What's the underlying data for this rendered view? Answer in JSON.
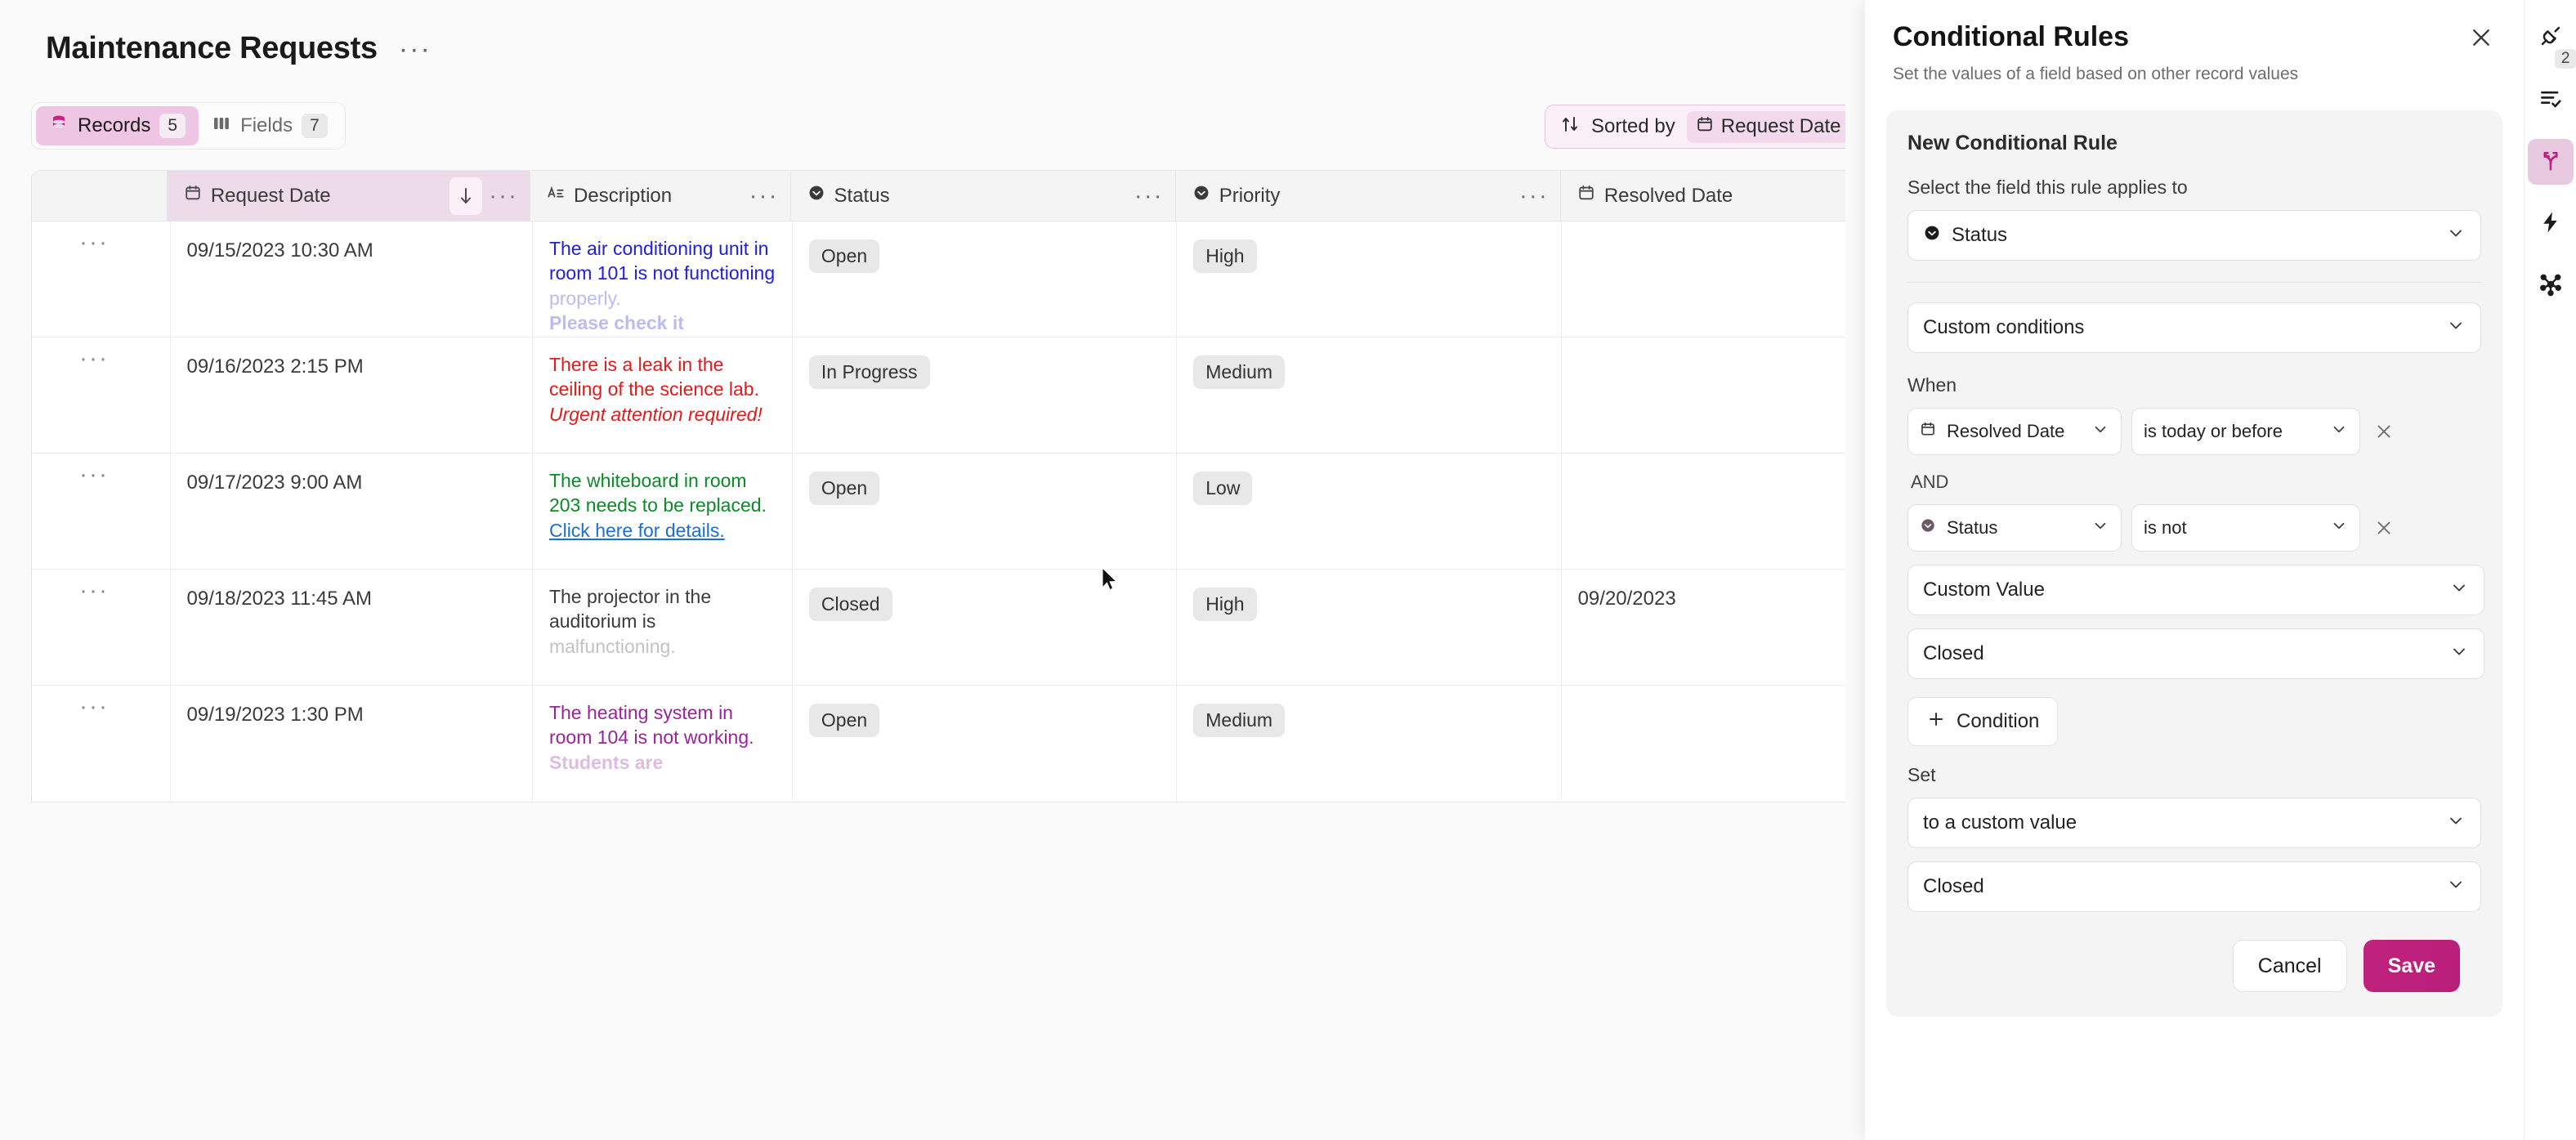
{
  "header": {
    "title": "Maintenance Requests",
    "more_label": "···",
    "segmented": [
      {
        "label": "Records",
        "count": "5",
        "icon": "records-icon",
        "active": true
      },
      {
        "label": "Fields",
        "count": "7",
        "icon": "fields-icon",
        "active": false
      }
    ],
    "sort": {
      "prefix": "Sorted by",
      "field": "Request Date",
      "icon": "sort-icon"
    }
  },
  "grid": {
    "columns": [
      {
        "key": "gutter",
        "label": "",
        "icon": ""
      },
      {
        "key": "date",
        "label": "Request Date",
        "icon": "calendar-icon"
      },
      {
        "key": "description",
        "label": "Description",
        "icon": "text-icon"
      },
      {
        "key": "status",
        "label": "Status",
        "icon": "select-icon"
      },
      {
        "key": "priority",
        "label": "Priority",
        "icon": "select-icon"
      },
      {
        "key": "resolved",
        "label": "Resolved Date",
        "icon": "calendar-icon"
      }
    ],
    "rows": [
      {
        "date": "09/15/2023 10:30 AM",
        "desc_lines": [
          {
            "text": "The air conditioning unit in",
            "color": "#2020d8",
            "style": "normal",
            "weight": "400",
            "underline": false,
            "fade": false
          },
          {
            "text": "room 101 is not functioning",
            "color": "#2020d8",
            "style": "normal",
            "weight": "400",
            "underline": false,
            "fade": false
          },
          {
            "text": "properly. ",
            "color": "#2020d8",
            "style": "normal",
            "weight": "400",
            "underline": false,
            "fade": true
          },
          {
            "text": "Please check it",
            "color": "#2020d8",
            "style": "normal",
            "weight": "700",
            "underline": false,
            "fade": true
          }
        ],
        "status": "Open",
        "priority": "High",
        "resolved": ""
      },
      {
        "date": "09/16/2023 2:15 PM",
        "desc_lines": [
          {
            "text": "There is a leak in the",
            "color": "#e01b1b",
            "style": "normal",
            "weight": "400",
            "underline": false,
            "fade": false
          },
          {
            "text": "ceiling of the science lab.",
            "color": "#e01b1b",
            "style": "normal",
            "weight": "400",
            "underline": false,
            "fade": false
          },
          {
            "text": "Urgent attention required!",
            "color": "#e01b1b",
            "style": "italic",
            "weight": "400",
            "underline": false,
            "fade": false
          }
        ],
        "status": "In Progress",
        "priority": "Medium",
        "resolved": ""
      },
      {
        "date": "09/17/2023 9:00 AM",
        "desc_lines": [
          {
            "text": "The whiteboard in room",
            "color": "#0b8a28",
            "style": "normal",
            "weight": "400",
            "underline": false,
            "fade": false
          },
          {
            "text": "203 needs to be replaced.",
            "color": "#0b8a28",
            "style": "normal",
            "weight": "400",
            "underline": false,
            "fade": false
          },
          {
            "text": "Click here for details.",
            "color": "#1a6fd4",
            "style": "normal",
            "weight": "400",
            "underline": true,
            "fade": false
          }
        ],
        "status": "Open",
        "priority": "Low",
        "resolved": ""
      },
      {
        "date": "09/18/2023 11:45 AM",
        "desc_lines": [
          {
            "text": "The projector in the",
            "color": "#3a3a3a",
            "style": "normal",
            "weight": "400",
            "underline": false,
            "fade": false
          },
          {
            "text": "auditorium is",
            "color": "#3a3a3a",
            "style": "normal",
            "weight": "400",
            "underline": false,
            "fade": false
          },
          {
            "text": "malfunctioning.",
            "color": "#3a3a3a",
            "style": "normal",
            "weight": "400",
            "underline": false,
            "fade": true
          }
        ],
        "status": "Closed",
        "priority": "High",
        "resolved": "09/20/2023"
      },
      {
        "date": "09/19/2023 1:30 PM",
        "desc_lines": [
          {
            "text": "The heating system in",
            "color": "#9a239a",
            "style": "normal",
            "weight": "400",
            "underline": false,
            "fade": false
          },
          {
            "text": "room 104 is not working.",
            "color": "#9a239a",
            "style": "normal",
            "weight": "400",
            "underline": false,
            "fade": false
          },
          {
            "text": "Students are",
            "color": "#9a239a",
            "style": "normal",
            "weight": "700",
            "underline": false,
            "fade": true
          }
        ],
        "status": "Open",
        "priority": "Medium",
        "resolved": ""
      }
    ]
  },
  "panel": {
    "title": "Conditional Rules",
    "subtitle": "Set the values of a field based on other record values",
    "card_title": "New Conditional Rule",
    "field_label": "Select the field this rule applies to",
    "field_value": "Status",
    "field_icon": "select-icon",
    "conditions_mode": "Custom conditions",
    "when_label": "When",
    "and_label": "AND",
    "conditions": [
      {
        "field": "Resolved Date",
        "field_icon": "calendar-icon",
        "operator": "is today or before",
        "value": null,
        "value2": null
      },
      {
        "field": "Status",
        "field_icon": "select-icon",
        "operator": "is not",
        "value": "Custom Value",
        "value2": "Closed"
      }
    ],
    "add_condition_label": "Condition",
    "set_label": "Set",
    "set_mode": "to a custom value",
    "set_value": "Closed",
    "cancel_label": "Cancel",
    "save_label": "Save",
    "accent": "#bc2078"
  },
  "rail": {
    "items": [
      {
        "icon": "plug-icon",
        "badge": "2",
        "active": false
      },
      {
        "icon": "list-check-icon",
        "badge": "",
        "active": false
      },
      {
        "icon": "branch-icon",
        "badge": "",
        "active": true
      },
      {
        "icon": "lightning-icon",
        "badge": "",
        "active": false
      },
      {
        "icon": "hub-icon",
        "badge": "",
        "active": false
      }
    ]
  }
}
